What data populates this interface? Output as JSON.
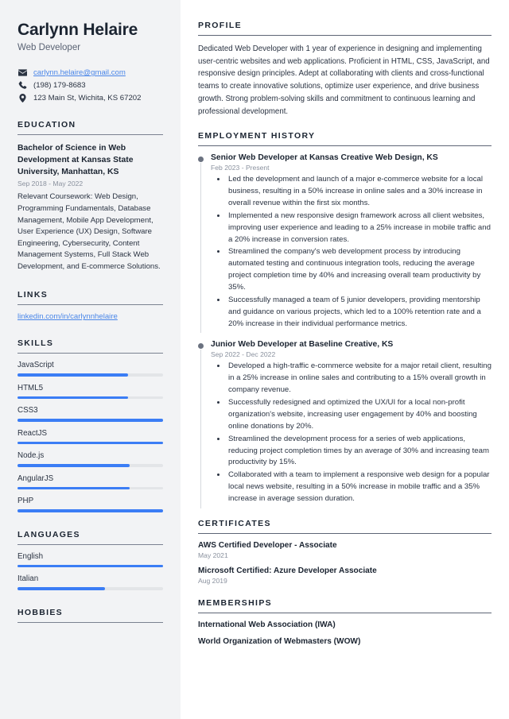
{
  "header": {
    "name": "Carlynn Helaire",
    "role": "Web Developer"
  },
  "contacts": [
    {
      "icon": "email-icon",
      "text": "carlynn.helaire@gmail.com",
      "is_link": true
    },
    {
      "icon": "phone-icon",
      "text": "(198) 179-8683",
      "is_link": false
    },
    {
      "icon": "location-pin-icon",
      "text": "123 Main St, Wichita, KS 67202",
      "is_link": false
    }
  ],
  "sidebar": {
    "education": {
      "title": "EDUCATION",
      "degree": "Bachelor of Science in Web Development at Kansas State University, Manhattan, KS",
      "date": "Sep 2018 - May 2022",
      "description": "Relevant Coursework: Web Design, Programming Fundamentals, Database Management, Mobile App Development, User Experience (UX) Design, Software Engineering, Cybersecurity, Content Management Systems, Full Stack Web Development, and E-commerce Solutions."
    },
    "links": {
      "title": "LINKS",
      "items": [
        {
          "label": "linkedin.com/in/carlynnhelaire"
        }
      ]
    },
    "skills": {
      "title": "SKILLS",
      "items": [
        {
          "label": "JavaScript",
          "level": 76
        },
        {
          "label": "HTML5",
          "level": 76
        },
        {
          "label": "CSS3",
          "level": 100
        },
        {
          "label": "ReactJS",
          "level": 100
        },
        {
          "label": "Node.js",
          "level": 77
        },
        {
          "label": "AngularJS",
          "level": 77
        },
        {
          "label": "PHP",
          "level": 100
        }
      ]
    },
    "languages": {
      "title": "LANGUAGES",
      "items": [
        {
          "label": "English",
          "level": 100
        },
        {
          "label": "Italian",
          "level": 60
        }
      ]
    },
    "hobbies": {
      "title": "HOBBIES"
    }
  },
  "main": {
    "profile": {
      "title": "PROFILE",
      "text": "Dedicated Web Developer with 1 year of experience in designing and implementing user-centric websites and web applications. Proficient in HTML, CSS, JavaScript, and responsive design principles. Adept at collaborating with clients and cross-functional teams to create innovative solutions, optimize user experience, and drive business growth. Strong problem-solving skills and commitment to continuous learning and professional development."
    },
    "employment": {
      "title": "EMPLOYMENT HISTORY",
      "jobs": [
        {
          "title": "Senior Web Developer at Kansas Creative Web Design, KS",
          "date": "Feb 2023 - Present",
          "bullets": [
            "Led the development and launch of a major e-commerce website for a local business, resulting in a 50% increase in online sales and a 30% increase in overall revenue within the first six months.",
            "Implemented a new responsive design framework across all client websites, improving user experience and leading to a 25% increase in mobile traffic and a 20% increase in conversion rates.",
            "Streamlined the company's web development process by introducing automated testing and continuous integration tools, reducing the average project completion time by 40% and increasing overall team productivity by 35%.",
            "Successfully managed a team of 5 junior developers, providing mentorship and guidance on various projects, which led to a 100% retention rate and a 20% increase in their individual performance metrics."
          ]
        },
        {
          "title": "Junior Web Developer at Baseline Creative, KS",
          "date": "Sep 2022 - Dec 2022",
          "bullets": [
            "Developed a high-traffic e-commerce website for a major retail client, resulting in a 25% increase in online sales and contributing to a 15% overall growth in company revenue.",
            "Successfully redesigned and optimized the UX/UI for a local non-profit organization's website, increasing user engagement by 40% and boosting online donations by 20%.",
            "Streamlined the development process for a series of web applications, reducing project completion times by an average of 30% and increasing team productivity by 15%.",
            "Collaborated with a team to implement a responsive web design for a popular local news website, resulting in a 50% increase in mobile traffic and a 35% increase in average session duration."
          ]
        }
      ]
    },
    "certificates": {
      "title": "CERTIFICATES",
      "items": [
        {
          "name": "AWS Certified Developer - Associate",
          "date": "May 2021"
        },
        {
          "name": "Microsoft Certified: Azure Developer Associate",
          "date": "Aug 2019"
        }
      ]
    },
    "memberships": {
      "title": "MEMBERSHIPS",
      "items": [
        {
          "name": "International Web Association (IWA)"
        },
        {
          "name": "World Organization of Webmasters (WOW)"
        }
      ]
    }
  },
  "colors": {
    "accent_blue": "#3b7df5",
    "link_blue": "#4a86e8",
    "heading": "#1b2431",
    "sidebar_bg": "#f2f3f5"
  }
}
